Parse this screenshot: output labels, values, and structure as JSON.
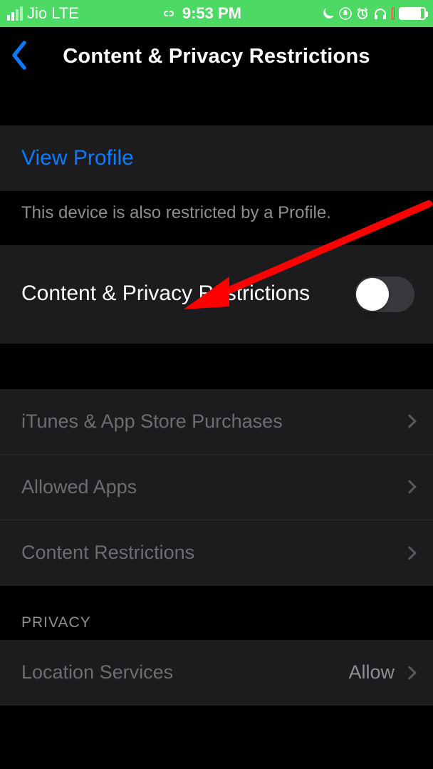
{
  "statusbar": {
    "carrier": "Jio",
    "network": "LTE",
    "time": "9:53 PM"
  },
  "nav": {
    "title": "Content & Privacy Restrictions"
  },
  "profile": {
    "view_label": "View Profile",
    "footer": "This device is also restricted by a Profile."
  },
  "toggle": {
    "label": "Content & Privacy Restrictions",
    "on": false
  },
  "items": {
    "itunes": "iTunes & App Store Purchases",
    "allowed": "Allowed Apps",
    "content": "Content Restrictions"
  },
  "privacy": {
    "header": "PRIVACY",
    "location": {
      "label": "Location Services",
      "value": "Allow"
    }
  }
}
